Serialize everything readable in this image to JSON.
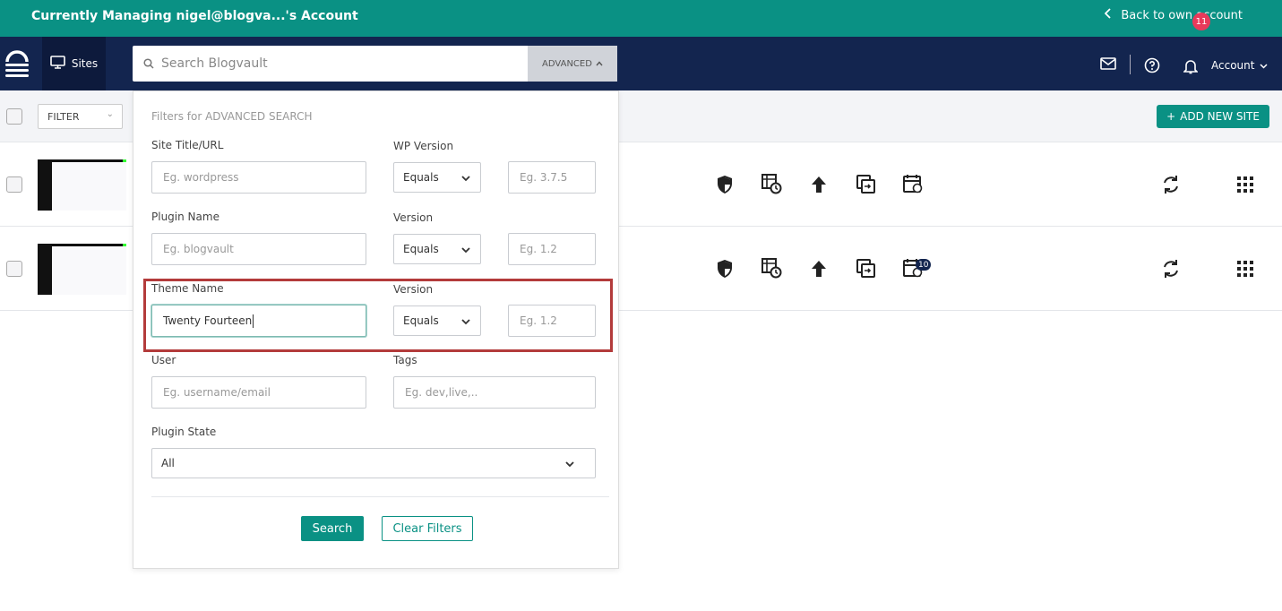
{
  "topbar": {
    "managing_text": "Currently Managing nigel@blogva...'s Account",
    "back_label": "Back to own account"
  },
  "nav": {
    "sites_label": "Sites",
    "search_placeholder": "Search Blogvault",
    "advanced_label": "ADVANCED",
    "notification_count": "11",
    "account_label": "Account"
  },
  "toolbar": {
    "filter_label": "FILTER",
    "add_site_label": "ADD NEW SITE"
  },
  "sites": [
    {
      "calendar_badge": ""
    },
    {
      "calendar_badge": "10"
    }
  ],
  "advanced_search": {
    "title": "Filters for ADVANCED SEARCH",
    "site_title": {
      "label": "Site Title/URL",
      "placeholder": "Eg. wordpress",
      "value": ""
    },
    "wp_version": {
      "label": "WP Version",
      "operator": "Equals",
      "placeholder": "Eg. 3.7.5"
    },
    "plugin_name": {
      "label": "Plugin Name",
      "placeholder": "Eg. blogvault",
      "value": ""
    },
    "plugin_version": {
      "label": "Version",
      "operator": "Equals",
      "placeholder": "Eg. 1.2"
    },
    "theme_name": {
      "label": "Theme Name",
      "value": "Twenty Fourteen"
    },
    "theme_version": {
      "label": "Version",
      "operator": "Equals",
      "placeholder": "Eg. 1.2"
    },
    "user": {
      "label": "User",
      "placeholder": "Eg. username/email"
    },
    "tags": {
      "label": "Tags",
      "placeholder": "Eg. dev,live,.."
    },
    "plugin_state": {
      "label": "Plugin State",
      "value": "All"
    },
    "search_button": "Search",
    "clear_button": "Clear Filters"
  },
  "colors": {
    "topbar": "#0a9184",
    "navbar": "#13254f",
    "accent": "#0a9184",
    "highlight_border": "#b33b3b",
    "badge": "#e83a5b"
  },
  "icons": [
    "search-icon",
    "monitor-icon",
    "mail-icon",
    "help-icon",
    "bell-icon",
    "shield-icon",
    "backup-schedule-icon",
    "upload-icon",
    "copy-icon",
    "calendar-sync-icon",
    "sync-icon",
    "grid-menu-icon"
  ]
}
